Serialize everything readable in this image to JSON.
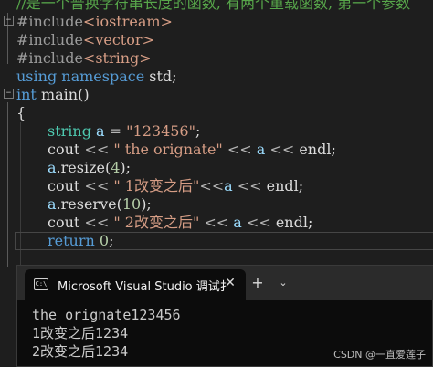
{
  "editor": {
    "lines": {
      "comment": "//是一个普换字符串长度的函数, 有两个重载函数, 第一个参数",
      "inc1_directive": "#include",
      "inc1_header": "<iostream>",
      "inc2_directive": "#include",
      "inc2_header": "<vector>",
      "inc3_directive": "#include",
      "inc3_header": "<string>",
      "using_kw1": "using",
      "using_kw2": "namespace",
      "using_ns": "std;",
      "main_kw": "int",
      "main_name": "main()",
      "brace_open": "{",
      "l1_type": "string",
      "l1_var": "a",
      "l1_op": " = ",
      "l1_str": "\"123456\"",
      "l1_end": ";",
      "l2_cout": "cout",
      "l2_op1": " << ",
      "l2_str": "\" the orignate\"",
      "l2_op2": " << ",
      "l2_var": "a",
      "l2_op3": " << ",
      "l2_endl": "endl;",
      "l3_var": "a",
      "l3_call": ".resize(",
      "l3_num": "4",
      "l3_end": ");",
      "l4_cout": "cout",
      "l4_op1": " << ",
      "l4_str": "\" 1改变之后\"",
      "l4_op2": "<<",
      "l4_var": "a",
      "l4_op3": " << ",
      "l4_endl": "endl;",
      "l5_var": "a",
      "l5_call": ".reserve(",
      "l5_num": "10",
      "l5_end": ");",
      "l6_cout": "cout",
      "l6_op1": " << ",
      "l6_str": "\" 2改变之后\"",
      "l6_op2": " << ",
      "l6_var": "a",
      "l6_op3": " << ",
      "l6_endl": "endl;",
      "ret_kw": "return",
      "ret_num": "0",
      "ret_end": ";"
    }
  },
  "console": {
    "tab_icon_text": "C:\\",
    "tab_title": "Microsoft Visual Studio 调试扌",
    "tab_close": "✕",
    "new_tab": "+",
    "dropdown": "⌄",
    "output": [
      "the orignate123456",
      "1改变之后1234",
      "2改变之后1234"
    ]
  },
  "watermark": "CSDN @一直爱莲子"
}
